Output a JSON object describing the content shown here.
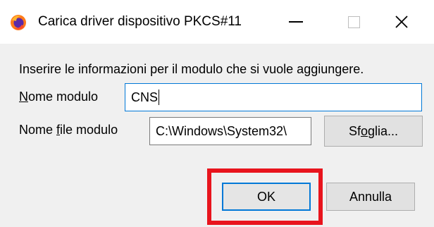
{
  "window": {
    "title": "Carica driver dispositivo PKCS#11",
    "icon": "firefox-icon",
    "controls": [
      "minimize-icon",
      "maximize-icon",
      "close-icon"
    ]
  },
  "dialog": {
    "instructions": "Inserire le informazioni per il modulo che si vuole aggiungere.",
    "module_name": {
      "label_prefix": "",
      "label_accesskey": "N",
      "label_rest": "ome modulo",
      "value": "CNS"
    },
    "module_file": {
      "label_prefix": "Nome ",
      "label_accesskey": "f",
      "label_rest": "ile modulo",
      "value": "C:\\Windows\\System32\\"
    },
    "browse_button": {
      "prefix": "Sf",
      "accesskey": "o",
      "rest": "glia..."
    },
    "ok_button": "OK",
    "cancel_button": "Annulla"
  },
  "colors": {
    "focus_accent": "#0078d7",
    "highlight_box": "#e8141d",
    "dialog_background": "#f0f0f0"
  }
}
